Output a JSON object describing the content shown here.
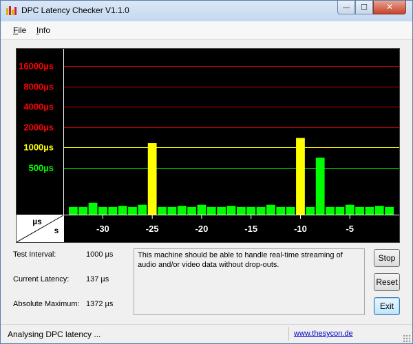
{
  "window": {
    "title": "DPC Latency Checker V1.1.0",
    "minimize_glyph": "—",
    "maximize_glyph": "☐",
    "close_glyph": "✕"
  },
  "menu": [
    {
      "label": "File",
      "accel": "F",
      "rest": "ile"
    },
    {
      "label": "Info",
      "accel": "I",
      "rest": "nfo"
    }
  ],
  "colors": {
    "green": "#00ff00",
    "yellow": "#ffff00",
    "red": "#ff0000",
    "grid_red": "#cc0000",
    "background": "#000000"
  },
  "chart_data": {
    "type": "bar",
    "title": "",
    "corner_labels": {
      "y_unit": "µs",
      "x_unit": "s"
    },
    "y_levels": [
      {
        "label": "16000µs",
        "value": 16000,
        "color": "red"
      },
      {
        "label": "8000µs",
        "value": 8000,
        "color": "red"
      },
      {
        "label": "4000µs",
        "value": 4000,
        "color": "red"
      },
      {
        "label": "2000µs",
        "value": 2000,
        "color": "red"
      },
      {
        "label": "1000µs",
        "value": 1000,
        "color": "yellow"
      },
      {
        "label": "500µs",
        "value": 500,
        "color": "green"
      }
    ],
    "x_ticks": [
      "-30",
      "-25",
      "-20",
      "-15",
      "-10",
      "-5"
    ],
    "x_tick_values": [
      -30,
      -25,
      -20,
      -15,
      -10,
      -5
    ],
    "xlim": [
      -34,
      0
    ],
    "scale": "log2",
    "bar_seconds": [
      -33,
      -32,
      -31,
      -30,
      -29,
      -28,
      -27,
      -26,
      -25,
      -24,
      -23,
      -22,
      -21,
      -20,
      -19,
      -18,
      -17,
      -16,
      -15,
      -14,
      -13,
      -12,
      -11,
      -10,
      -9,
      -8,
      -7,
      -6,
      -5,
      -4,
      -3,
      -2,
      -1
    ],
    "values": [
      130,
      130,
      150,
      130,
      130,
      135,
      130,
      140,
      1150,
      130,
      130,
      135,
      130,
      140,
      130,
      130,
      135,
      130,
      130,
      130,
      140,
      130,
      130,
      1372,
      130,
      700,
      130,
      130,
      140,
      130,
      130,
      135,
      130
    ],
    "bar_colors": [
      "green",
      "green",
      "green",
      "green",
      "green",
      "green",
      "green",
      "green",
      "yellow",
      "green",
      "green",
      "green",
      "green",
      "green",
      "green",
      "green",
      "green",
      "green",
      "green",
      "green",
      "green",
      "green",
      "green",
      "yellow",
      "green",
      "green",
      "green",
      "green",
      "green",
      "green",
      "green",
      "green",
      "green"
    ]
  },
  "stats": {
    "test_interval": {
      "label": "Test Interval:",
      "value": "1000 µs"
    },
    "current_latency": {
      "label": "Current Latency:",
      "value": "137 µs"
    },
    "absolute_maximum": {
      "label": "Absolute Maximum:",
      "value": "1372 µs"
    }
  },
  "message": "This machine should be able to handle real-time streaming of audio and/or video data without drop-outs.",
  "buttons": {
    "stop": "Stop",
    "reset": "Reset",
    "exit": "Exit"
  },
  "status": {
    "text": "Analysing DPC latency ...",
    "link": "www.thesycon.de"
  }
}
